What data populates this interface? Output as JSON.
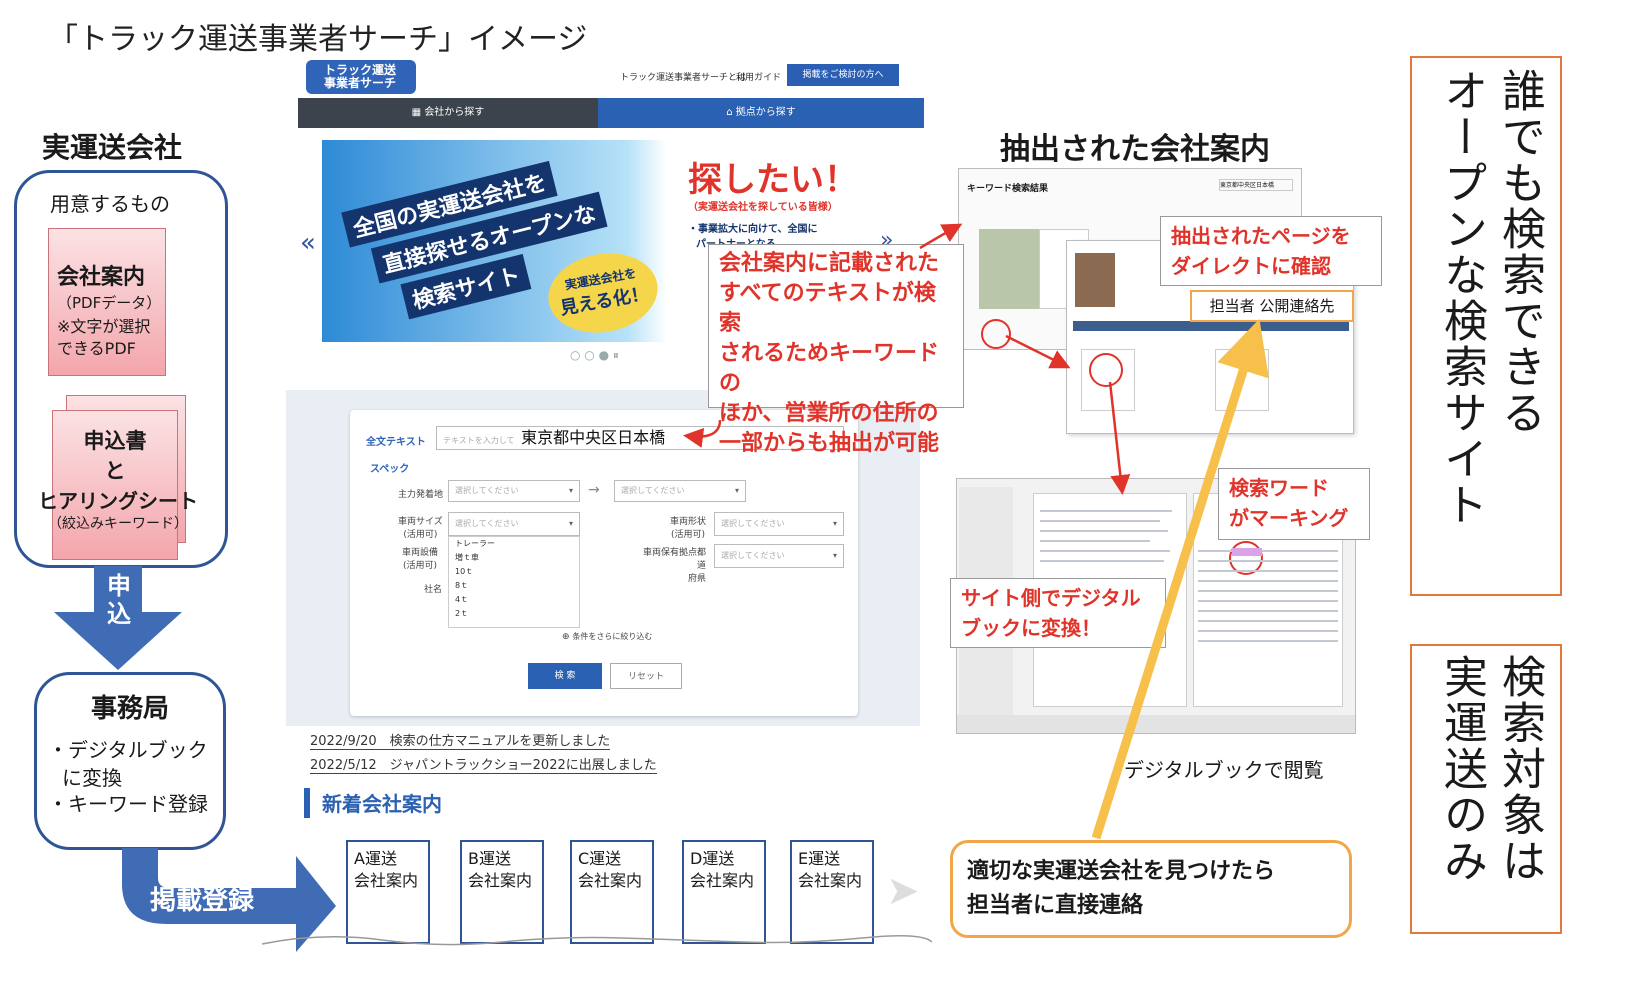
{
  "title": "「トラック運送事業者サーチ」イメージ",
  "left": {
    "heading": "実運送会社",
    "prep_label": "用意するもの",
    "card1": {
      "line1": "会社案内",
      "line2": "（PDFデータ）",
      "line3": "※文字が選択",
      "line4": "できるPDF"
    },
    "card2": {
      "line1": "申込書",
      "line2": "と",
      "line3": "ヒアリングシート",
      "line4": "（絞込みキーワード）"
    },
    "apply_arrow": {
      "char1": "申",
      "char2": "込"
    },
    "office": {
      "title": "事務局",
      "item1": "・デジタルブック",
      "item1b": "に変換",
      "item2": "・キーワード登録"
    },
    "register_label": "掲載登録"
  },
  "site": {
    "logo_text_1": "トラック運送",
    "logo_text_2": "事業者サーチ",
    "nav_about": "トラック運送事業者サーチとは",
    "nav_guide": "利用ガイド",
    "nav_button": "掲載をご検討の方へ",
    "tab_company": "会社から探す",
    "tab_base": "拠点から探す",
    "banner": {
      "headline_1": "全国の実運送会社を",
      "headline_2": "直接探せるオープンな",
      "headline_3": "検索サイト",
      "want": "探したい！",
      "want_sub": "（実運送会社を探している皆様）",
      "bullet1": "・事業拡大に向けて、全国に",
      "bullet2": "パートナーとなる",
      "visualize_1": "実運送会社を",
      "visualize_2": "見える化！"
    },
    "search": {
      "fulltext_label": "全文テキスト",
      "fulltext_placeholder": "テキストを入力して",
      "fulltext_value": "東京都中央区日本橋",
      "spec_label": "スペック",
      "origin_label": "主力発着地",
      "select_placeholder": "選択してください",
      "vehicle_size_label": "車両サイズ",
      "vehicle_size_sub": "(活用可)",
      "vehicle_shape_label": "車両形状",
      "vehicle_shape_sub": "(活用可)",
      "equipment_label": "車両設備",
      "equipment_sub": "(活用可)",
      "base_pref_label_1": "車両保有拠点都道",
      "base_pref_label_2": "府県",
      "company_label": "社名",
      "dropdown_options": [
        "トレーラー",
        "増ｔ車",
        "10ｔ",
        "8ｔ",
        "4ｔ",
        "2ｔ"
      ],
      "more_conditions": "条件をさらに絞り込む",
      "search_button": "検 索",
      "reset_button": "リセット"
    },
    "news": [
      "2022/9/20　検索の仕方マニュアルを更新しました",
      "2022/5/12　ジャパントラックショー2022に出展しました"
    ],
    "new_companies_title": "新着会社案内",
    "companies": [
      {
        "l1": "A運送",
        "l2": "会社案内"
      },
      {
        "l1": "B運送",
        "l2": "会社案内"
      },
      {
        "l1": "C運送",
        "l2": "会社案内"
      },
      {
        "l1": "D運送",
        "l2": "会社案内"
      },
      {
        "l1": "E運送",
        "l2": "会社案内"
      }
    ]
  },
  "right": {
    "heading": "抽出された会社案内",
    "result_title": "キーワード検索結果",
    "result_keyword": "東京都中央区日本橋",
    "explain": [
      "会社案内に記載された",
      "すべてのテキストが検索",
      "されるためキーワードの",
      "ほか、営業所の住所の",
      "一部からも抽出が可能"
    ],
    "direct": [
      "抽出されたページを",
      "ダイレクトに確認"
    ],
    "contact_tag": "担当者 公開連絡先",
    "marking": [
      "検索ワード",
      "がマーキング"
    ],
    "convert": [
      "サイト側でデジタル",
      "ブックに変換！"
    ],
    "digital_label": "デジタルブックで閲覧",
    "contact_box": [
      "適切な実運送会社を見つけたら",
      "担当者に直接連絡"
    ]
  },
  "side": {
    "box1_col1": "誰でも検索できる",
    "box1_col2": "オープンな検索サイト",
    "box2_col1": "検索対象は",
    "box2_col2": "実運送のみ"
  },
  "colors": {
    "navy": "#2f5597",
    "accent_blue": "#2b61b2",
    "red": "#e0332a",
    "orange": "#f2a649",
    "yellow_arrow": "#f7c04a"
  }
}
